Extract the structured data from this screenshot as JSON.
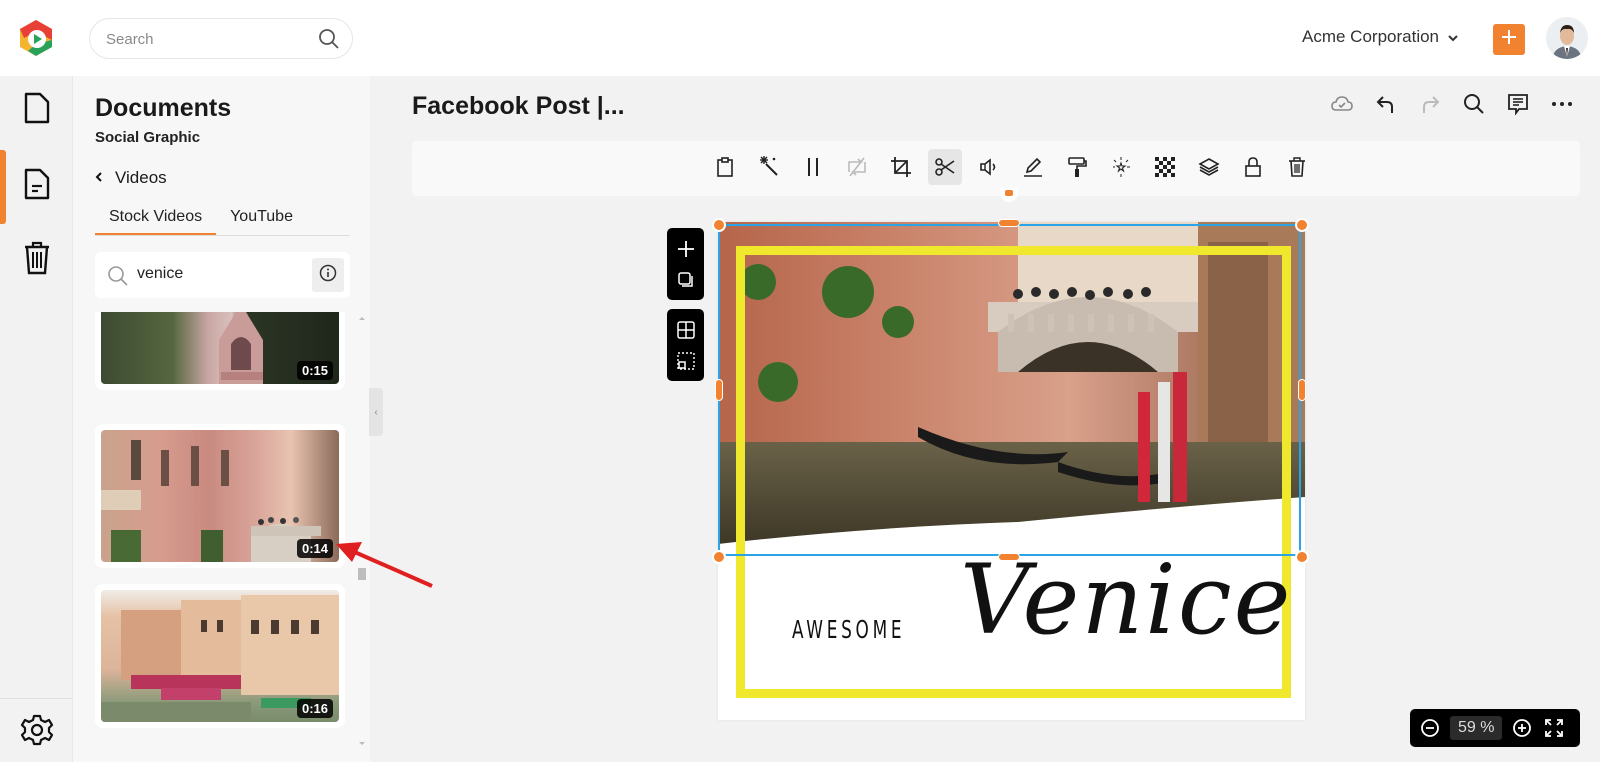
{
  "topbar": {
    "search_placeholder": "Search",
    "org_name": "Acme Corporation",
    "brand_color": "#f08230"
  },
  "rail": {
    "items": [
      {
        "icon": "document-icon",
        "label": "Documents"
      },
      {
        "icon": "document-text-icon",
        "label": "Social Graphic",
        "active": true
      },
      {
        "icon": "trash-icon",
        "label": "Trash"
      }
    ],
    "settings_icon": "gear-icon"
  },
  "panel": {
    "title": "Documents",
    "subtitle": "Social Graphic",
    "back_label": "Videos",
    "tabs": [
      {
        "label": "Stock Videos",
        "active": true
      },
      {
        "label": "YouTube",
        "active": false
      }
    ],
    "search_value": "venice",
    "videos": [
      {
        "duration": "0:15",
        "scene": "gothic church among trees"
      },
      {
        "duration": "0:14",
        "scene": "pink buildings street with bridge"
      },
      {
        "duration": "0:16",
        "scene": "grand canal waterfront with awnings"
      }
    ]
  },
  "editor": {
    "doc_title": "Facebook Post |...",
    "top_actions": [
      "cloud-saved-icon",
      "undo-icon",
      "redo-icon",
      "search-icon",
      "comment-icon",
      "more-icon"
    ],
    "tools": [
      "clipboard-icon",
      "magic-wand-icon",
      "split-icon",
      "flip-icon",
      "crop-icon",
      "scissors-icon",
      "volume-icon",
      "pencil-icon",
      "paint-roller-icon",
      "sparkle-icon",
      "transparency-icon",
      "layers-icon",
      "lock-icon",
      "trash-icon"
    ],
    "active_tool": "scissors-icon",
    "float_tools": [
      "add-icon",
      "duplicate-icon",
      "grid-icon",
      "select-area-icon"
    ],
    "canvas": {
      "text_small": "AWESOME",
      "text_script": "Venice",
      "frame_color": "#f0e82c",
      "selection_color": "#2aa4e6"
    },
    "zoom": {
      "value": "59",
      "unit": "%"
    }
  }
}
